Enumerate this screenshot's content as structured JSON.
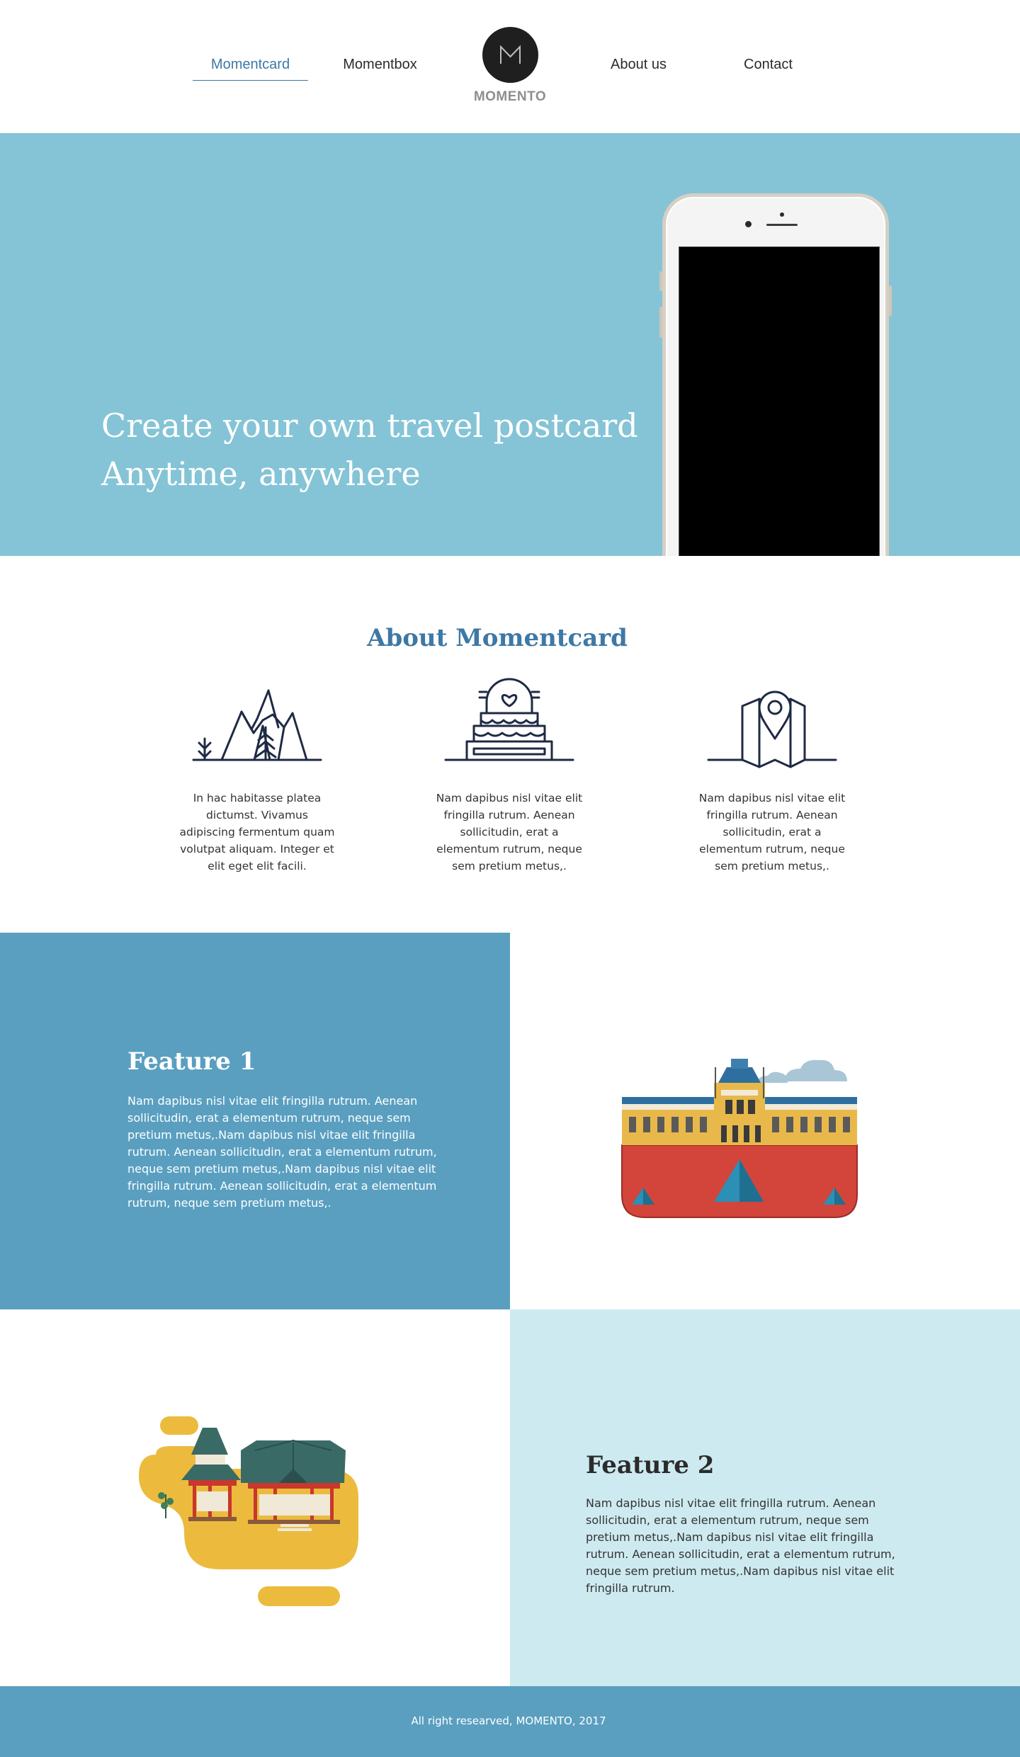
{
  "nav": {
    "items": [
      {
        "label": "Momentcard",
        "active": true
      },
      {
        "label": "Momentbox",
        "active": false
      },
      {
        "label": "About us",
        "active": false
      },
      {
        "label": "Contact",
        "active": false
      }
    ],
    "logo_text": "MOMENTO",
    "logo_icon": "m-monogram-icon"
  },
  "hero": {
    "line1": "Create your own travel postcard",
    "line2": "Anytime, anywhere"
  },
  "about": {
    "title": "About Momentcard",
    "items": [
      {
        "icon": "mountains-icon",
        "text": "In hac habitasse platea dictumst. Vivamus adipiscing fermentum quam volutpat aliquam. Integer et elit eget elit facili."
      },
      {
        "icon": "wedding-cake-icon",
        "text": "Nam dapibus nisl vitae elit fringilla rutrum. Aenean sollicitudin, erat a elementum rutrum, neque sem pretium metus,."
      },
      {
        "icon": "map-pin-icon",
        "text": "Nam dapibus nisl vitae elit fringilla rutrum. Aenean sollicitudin, erat a elementum rutrum, neque sem pretium metus,."
      }
    ]
  },
  "feature1": {
    "title": "Feature 1",
    "text": "Nam dapibus nisl vitae elit fringilla rutrum. Aenean sollicitudin, erat a elementum rutrum, neque sem pretium metus,.Nam dapibus nisl vitae elit fringilla rutrum. Aenean sollicitudin, erat a elementum rutrum, neque sem pretium metus,.Nam dapibus nisl vitae elit fringilla rutrum. Aenean sollicitudin, erat a elementum rutrum, neque sem pretium metus,.",
    "illustration": "louvre-museum-illustration"
  },
  "feature2": {
    "title": "Feature 2",
    "text": "Nam dapibus nisl vitae elit fringilla rutrum. Aenean sollicitudin, erat a elementum rutrum, neque sem pretium metus,.Nam dapibus nisl vitae elit fringilla rutrum. Aenean sollicitudin, erat a elementum rutrum, neque sem pretium metus,.Nam dapibus nisl vitae elit fringilla rutrum.",
    "illustration": "japanese-temple-illustration"
  },
  "footer": {
    "text": "All right researved, MOMENTO, 2017"
  },
  "colors": {
    "accent": "#3e78a5",
    "hero_bg": "#84c4d6",
    "feature_blue": "#5a9fc0",
    "feature_light": "#cdeaf0",
    "icon_stroke": "#1f2a44"
  }
}
